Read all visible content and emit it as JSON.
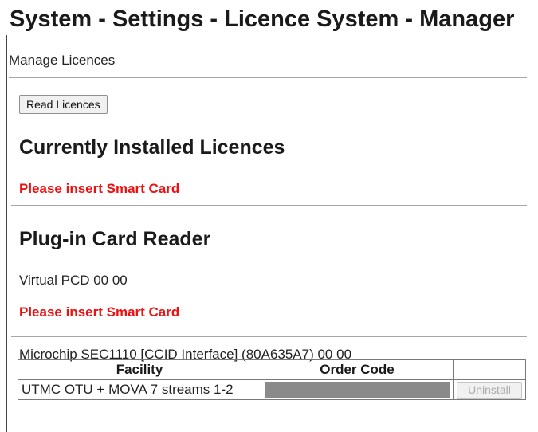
{
  "page": {
    "title": "System - Settings - Licence System - Manager",
    "subtitle": "Manage Licences"
  },
  "actions": {
    "read_licences_label": "Read Licences"
  },
  "installed": {
    "heading": "Currently Installed Licences",
    "status": "Please insert Smart Card"
  },
  "card_reader": {
    "heading": "Plug-in Card Reader",
    "readers": [
      {
        "name": "Virtual PCD 00 00",
        "status": "Please insert Smart Card"
      },
      {
        "name": "Microchip SEC1110 [CCID Interface] (80A635A7) 00 00"
      }
    ]
  },
  "licence_table": {
    "columns": [
      "Facility",
      "Order Code",
      ""
    ],
    "rows": [
      {
        "facility": "UTMC OTU + MOVA 7 streams 1-2",
        "order_code": "",
        "action_label": "Uninstall",
        "action_enabled": false
      }
    ]
  },
  "colors": {
    "warning": "#ee1111",
    "redaction_bar": "#8a8a8a",
    "rule": "#a6a6a6"
  }
}
